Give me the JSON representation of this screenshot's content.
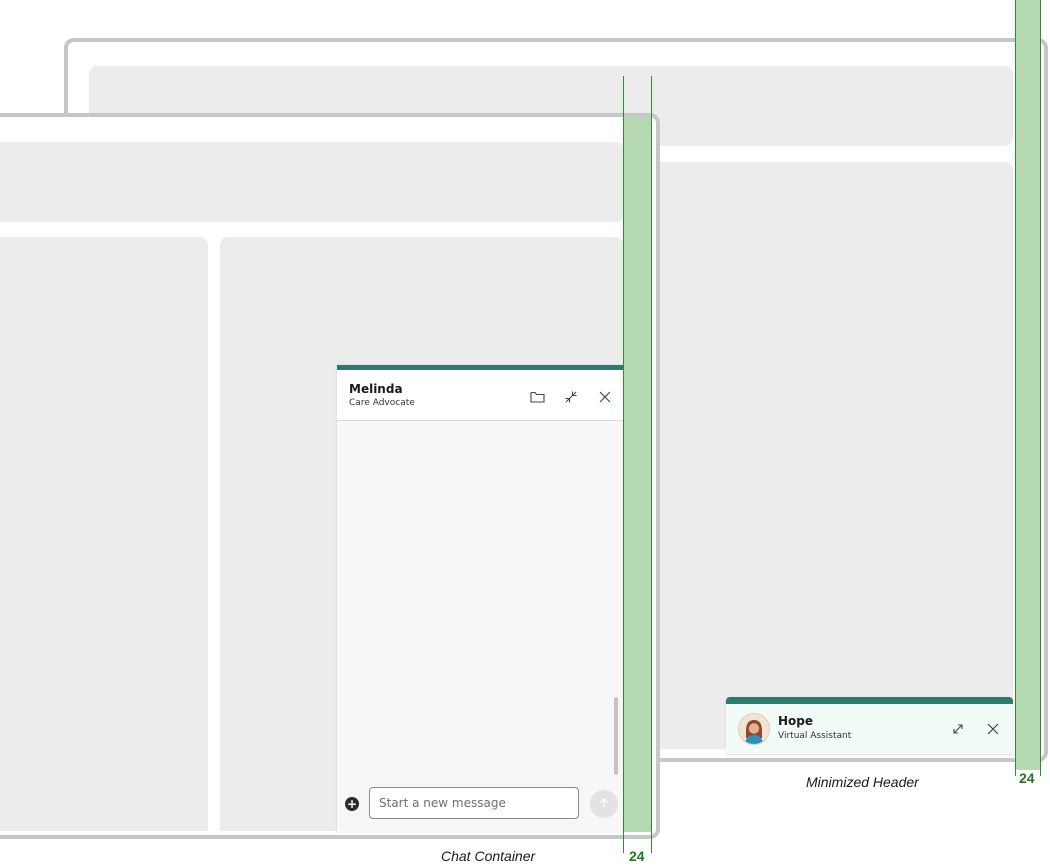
{
  "chat_container": {
    "agent_name": "Melinda",
    "agent_role": "Care Advocate",
    "icons": [
      "folder-icon",
      "minimize-icon",
      "close-icon"
    ],
    "message_placeholder": "Start a new message",
    "attach_icon": "plus-icon",
    "send_icon": "send-arrow-icon",
    "accent_color": "#2e7a6c"
  },
  "minimized_header": {
    "agent_name": "Hope",
    "agent_role": "Virtual Assistant",
    "icons": [
      "avatar-icon",
      "expand-icon",
      "close-icon"
    ],
    "accent_color": "#2e7a6c",
    "background_color": "#f1fbf8"
  },
  "annotations": {
    "chat_container_caption": "Chat Container",
    "minimized_header_caption": "Minimized Header",
    "margin_front": "24",
    "margin_back": "24",
    "guide_color": "#b5d9b1"
  }
}
